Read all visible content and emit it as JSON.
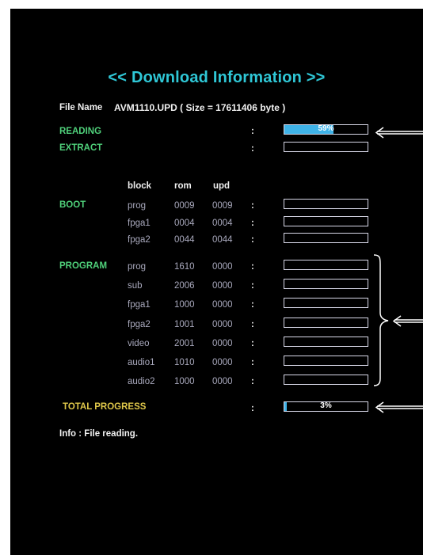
{
  "title": "<< Download Information >>",
  "file": {
    "label": "File Name",
    "value": "AVM1110.UPD  ( Size = 17611406  byte )"
  },
  "reading": {
    "label": "READING",
    "progress_percent": 59,
    "progress_text": "59%"
  },
  "extract": {
    "label": "EXTRACT",
    "progress_percent": 0,
    "progress_text": ""
  },
  "columns": {
    "block": "block",
    "rom": "rom",
    "upd": "upd"
  },
  "boot": {
    "label": "BOOT",
    "rows": [
      {
        "block": "prog",
        "rom": "0009",
        "upd": "0009"
      },
      {
        "block": "fpga1",
        "rom": "0004",
        "upd": "0004"
      },
      {
        "block": "fpga2",
        "rom": "0044",
        "upd": "0044"
      }
    ]
  },
  "program": {
    "label": "PROGRAM",
    "rows": [
      {
        "block": "prog",
        "rom": "1610",
        "upd": "0000"
      },
      {
        "block": "sub",
        "rom": "2006",
        "upd": "0000"
      },
      {
        "block": "fpga1",
        "rom": "1000",
        "upd": "0000"
      },
      {
        "block": "fpga2",
        "rom": "1001",
        "upd": "0000"
      },
      {
        "block": "video",
        "rom": "2001",
        "upd": "0000"
      },
      {
        "block": "audio1",
        "rom": "1010",
        "upd": "0000"
      },
      {
        "block": "audio2",
        "rom": "1000",
        "upd": "0000"
      }
    ]
  },
  "total": {
    "label": "TOTAL PROGRESS",
    "progress_percent": 3,
    "progress_text": "3%"
  },
  "colon": ":",
  "info": "Info : File reading.",
  "colors": {
    "background": "#000000",
    "title": "#2fc7d6",
    "section_label": "#4fd07a",
    "total_label": "#e0c84a",
    "progress_fill": "#3fb3e8",
    "bar_border": "#d8d8e8"
  }
}
